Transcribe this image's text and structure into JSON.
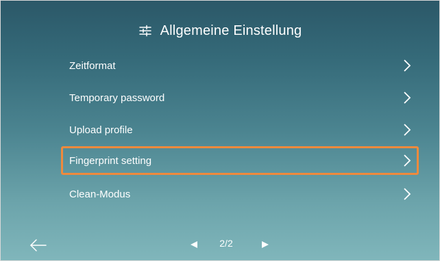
{
  "header": {
    "title": "Allgemeine Einstellung",
    "icon": "sliders-icon"
  },
  "menu": {
    "items": [
      {
        "label": "Zeitformat",
        "icon": "chevron-right-icon"
      },
      {
        "label": "Temporary password",
        "icon": "chevron-right-icon"
      },
      {
        "label": "Upload profile",
        "icon": "chevron-right-icon"
      },
      {
        "label": "Fingerprint setting",
        "icon": "chevron-right-icon",
        "highlighted": true
      },
      {
        "label": "Clean-Modus",
        "icon": "chevron-right-icon"
      }
    ]
  },
  "footer": {
    "back_icon": "arrow-left-icon",
    "prev_icon": "triangle-left-icon",
    "next_icon": "triangle-right-icon",
    "page_indicator": "2/2"
  },
  "colors": {
    "highlight_border": "#f08a3c",
    "background_top": "#2b5868",
    "background_bottom": "#80b6bb",
    "text": "#ffffff"
  }
}
